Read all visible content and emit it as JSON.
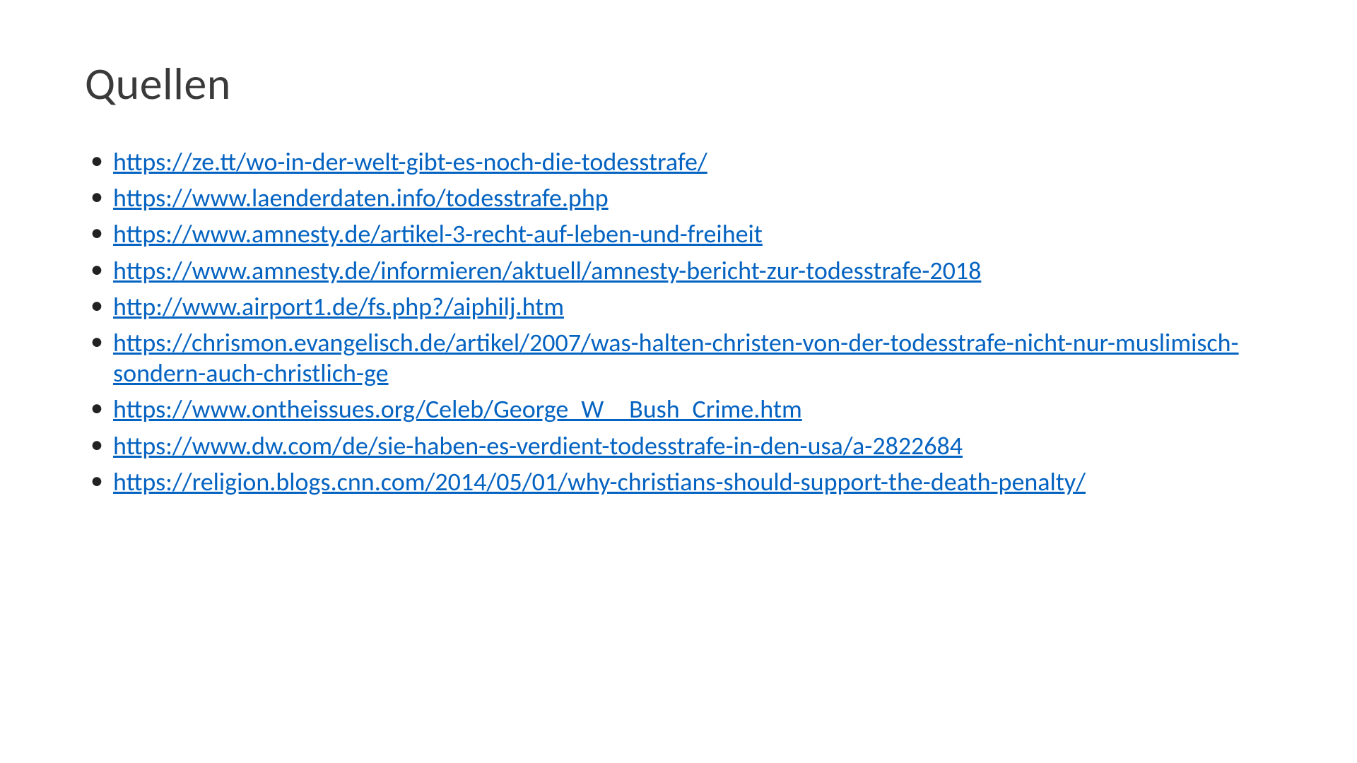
{
  "title": "Quellen",
  "sources": [
    "https://ze.tt/wo-in-der-welt-gibt-es-noch-die-todesstrafe/",
    "https://www.laenderdaten.info/todesstrafe.php",
    "https://www.amnesty.de/artikel-3-recht-auf-leben-und-freiheit",
    "https://www.amnesty.de/informieren/aktuell/amnesty-bericht-zur-todesstrafe-2018",
    "http://www.airport1.de/fs.php?/aiphilj.htm",
    "https://chrismon.evangelisch.de/artikel/2007/was-halten-christen-von-der-todesstrafe-nicht-nur-muslimisch-sondern-auch-christlich-ge",
    "https://www.ontheissues.org/Celeb/George_W__Bush_Crime.htm",
    "https://www.dw.com/de/sie-haben-es-verdient-todesstrafe-in-den-usa/a-2822684",
    "https://religion.blogs.cnn.com/2014/05/01/why-christians-should-support-the-death-penalty/"
  ]
}
